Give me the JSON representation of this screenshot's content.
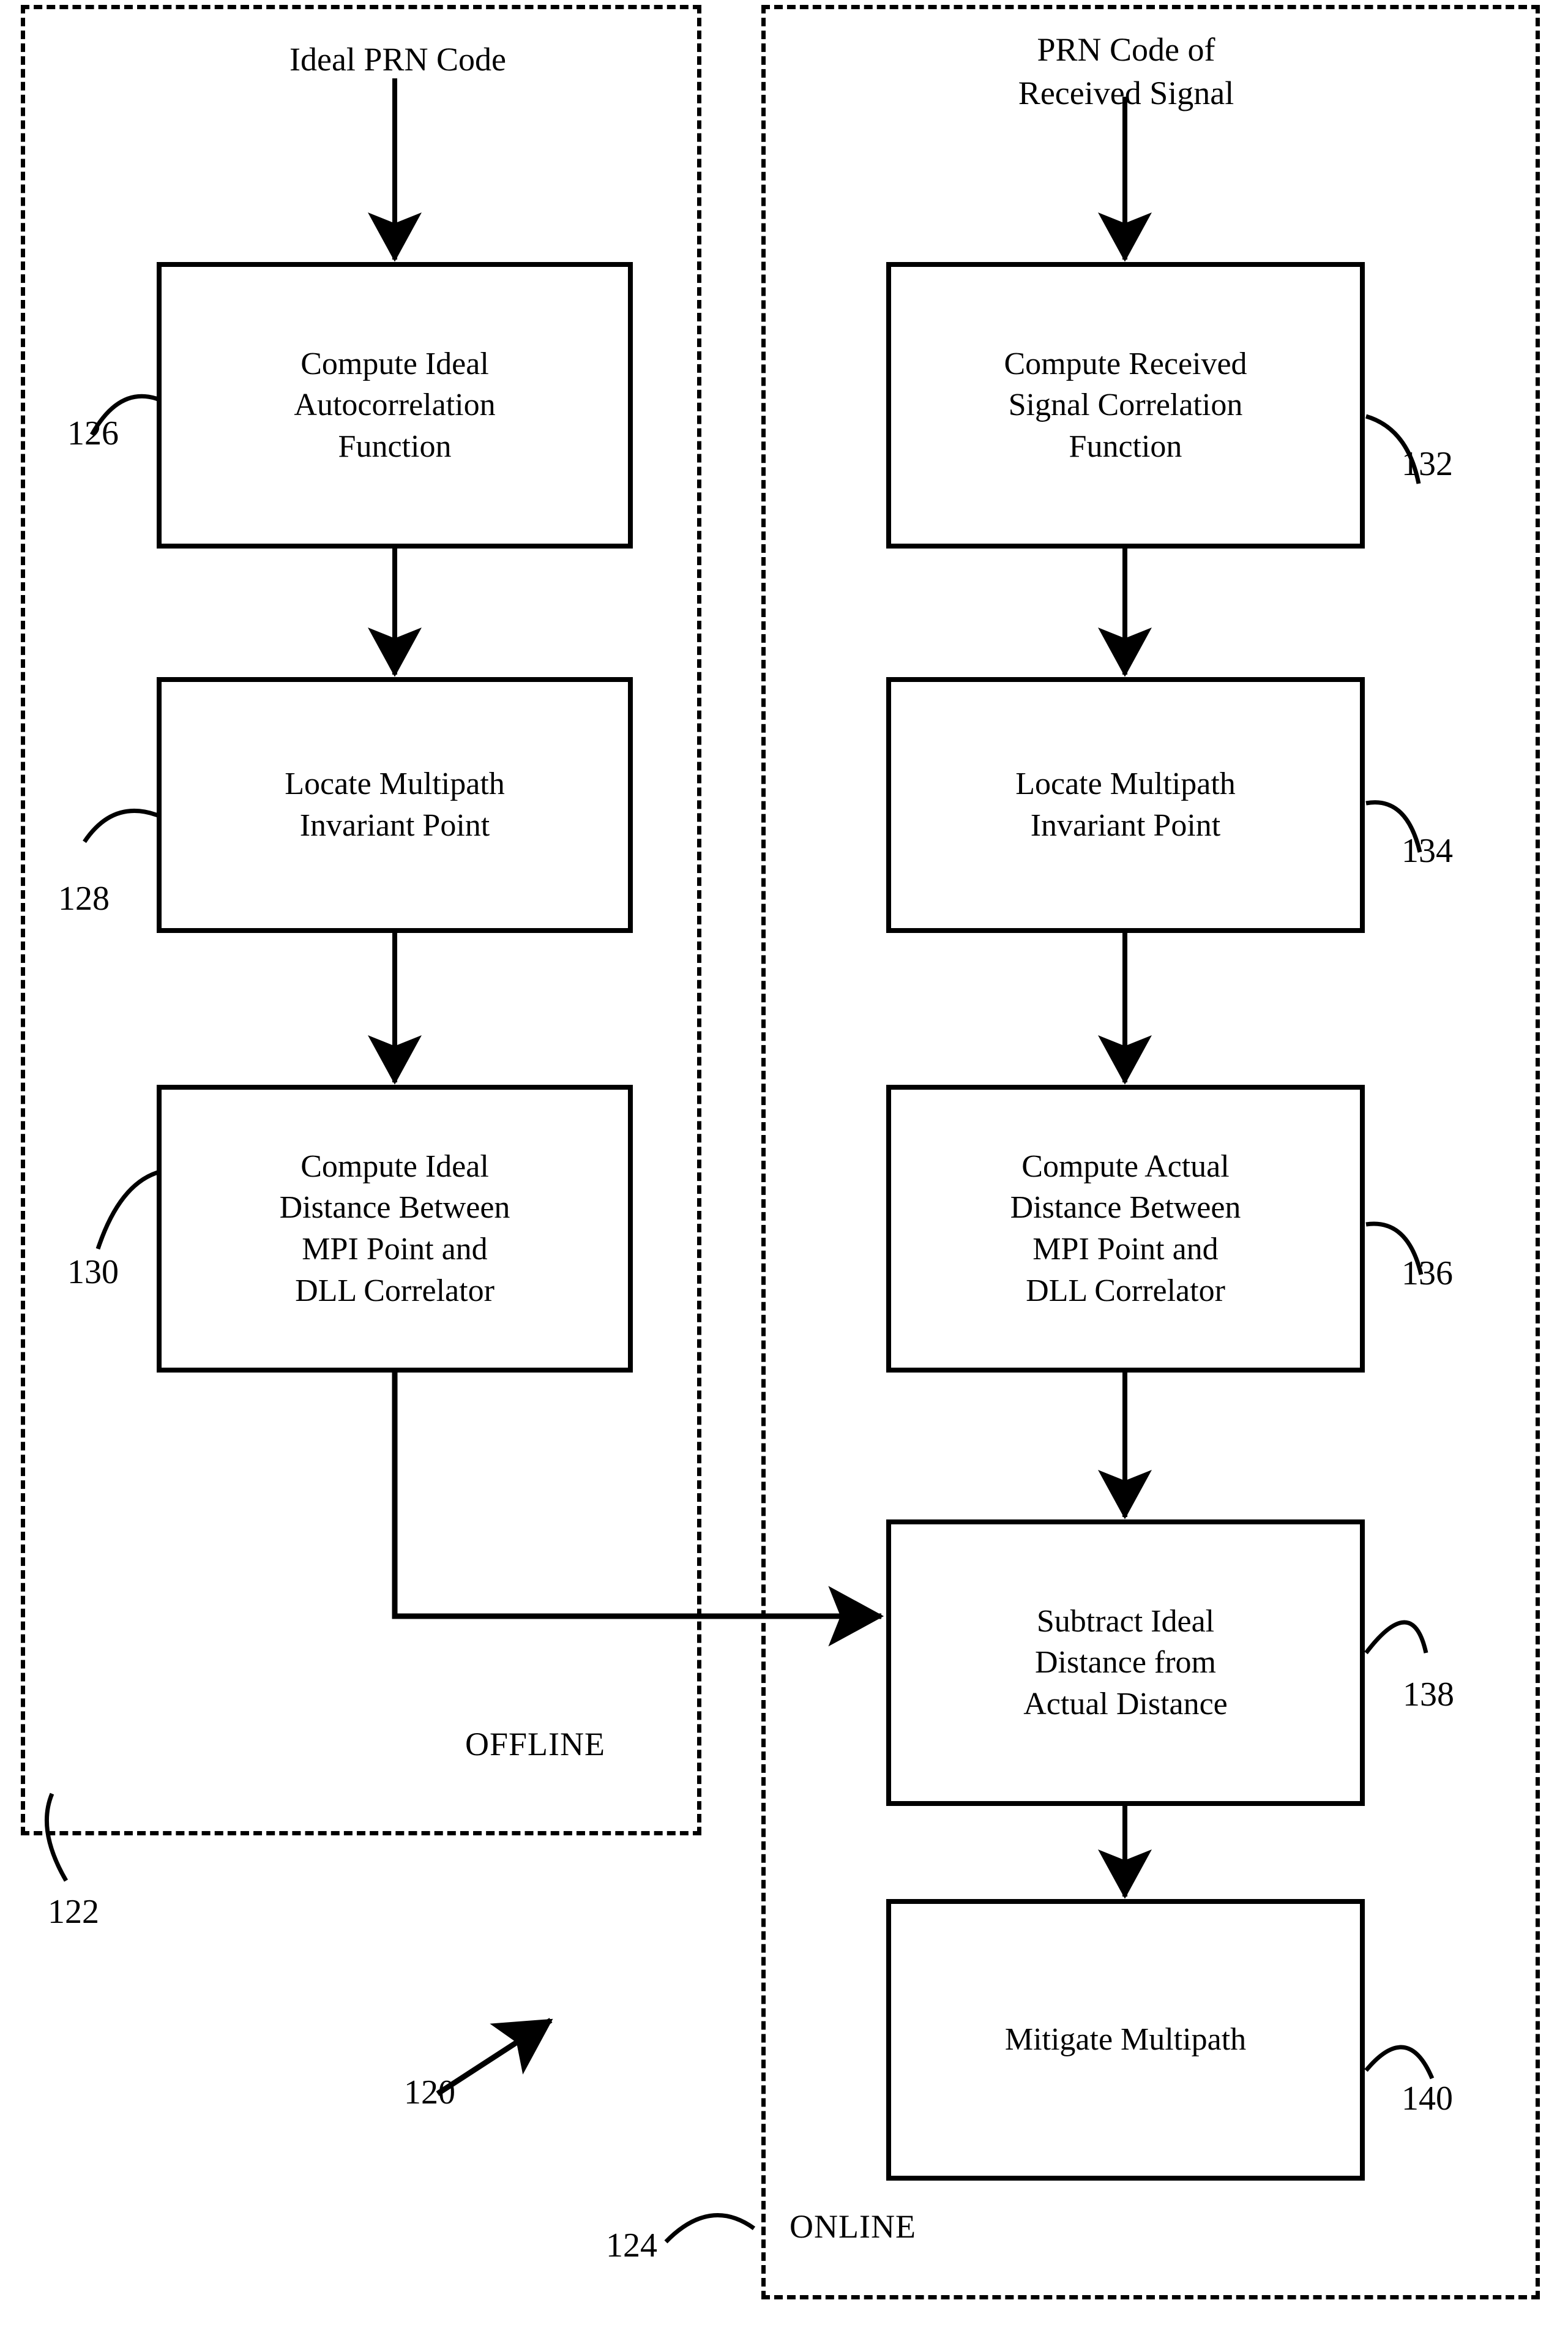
{
  "figure": {
    "number": "120",
    "type": "flowchart",
    "panels": [
      {
        "id": "offline",
        "label": "OFFLINE",
        "ref": "122"
      },
      {
        "id": "online",
        "label": "ONLINE",
        "ref": "124"
      }
    ],
    "sources": [
      {
        "id": "ideal_prn",
        "text": "Ideal PRN Code"
      },
      {
        "id": "received_prn",
        "text": "PRN Code of\nReceived Signal"
      }
    ],
    "steps": [
      {
        "ref": "126",
        "panel": "offline",
        "text": "Compute Ideal\nAutocorrelation\nFunction"
      },
      {
        "ref": "128",
        "panel": "offline",
        "text": "Locate Multipath\nInvariant Point"
      },
      {
        "ref": "130",
        "panel": "offline",
        "text": "Compute Ideal\nDistance Between\nMPI Point and\nDLL Correlator"
      },
      {
        "ref": "132",
        "panel": "online",
        "text": "Compute Received\nSignal Correlation\nFunction"
      },
      {
        "ref": "134",
        "panel": "online",
        "text": "Locate Multipath\nInvariant Point"
      },
      {
        "ref": "136",
        "panel": "online",
        "text": "Compute Actual\nDistance Between\nMPI Point and\nDLL Correlator"
      },
      {
        "ref": "138",
        "panel": "online",
        "text": "Subtract Ideal\nDistance from\nActual Distance"
      },
      {
        "ref": "140",
        "panel": "online",
        "text": "Mitigate Multipath"
      }
    ],
    "connections": [
      {
        "from": "ideal_prn",
        "to": "126",
        "kind": "arrow-down"
      },
      {
        "from": "126",
        "to": "128",
        "kind": "arrow-down"
      },
      {
        "from": "128",
        "to": "130",
        "kind": "arrow-down"
      },
      {
        "from": "received_prn",
        "to": "132",
        "kind": "arrow-down"
      },
      {
        "from": "132",
        "to": "134",
        "kind": "arrow-down"
      },
      {
        "from": "134",
        "to": "136",
        "kind": "arrow-down"
      },
      {
        "from": "136",
        "to": "138",
        "kind": "arrow-down"
      },
      {
        "from": "130",
        "to": "138",
        "kind": "elbow-right"
      },
      {
        "from": "138",
        "to": "140",
        "kind": "arrow-down"
      }
    ],
    "colors": {
      "ink": "#000000",
      "paper": "#ffffff"
    }
  }
}
